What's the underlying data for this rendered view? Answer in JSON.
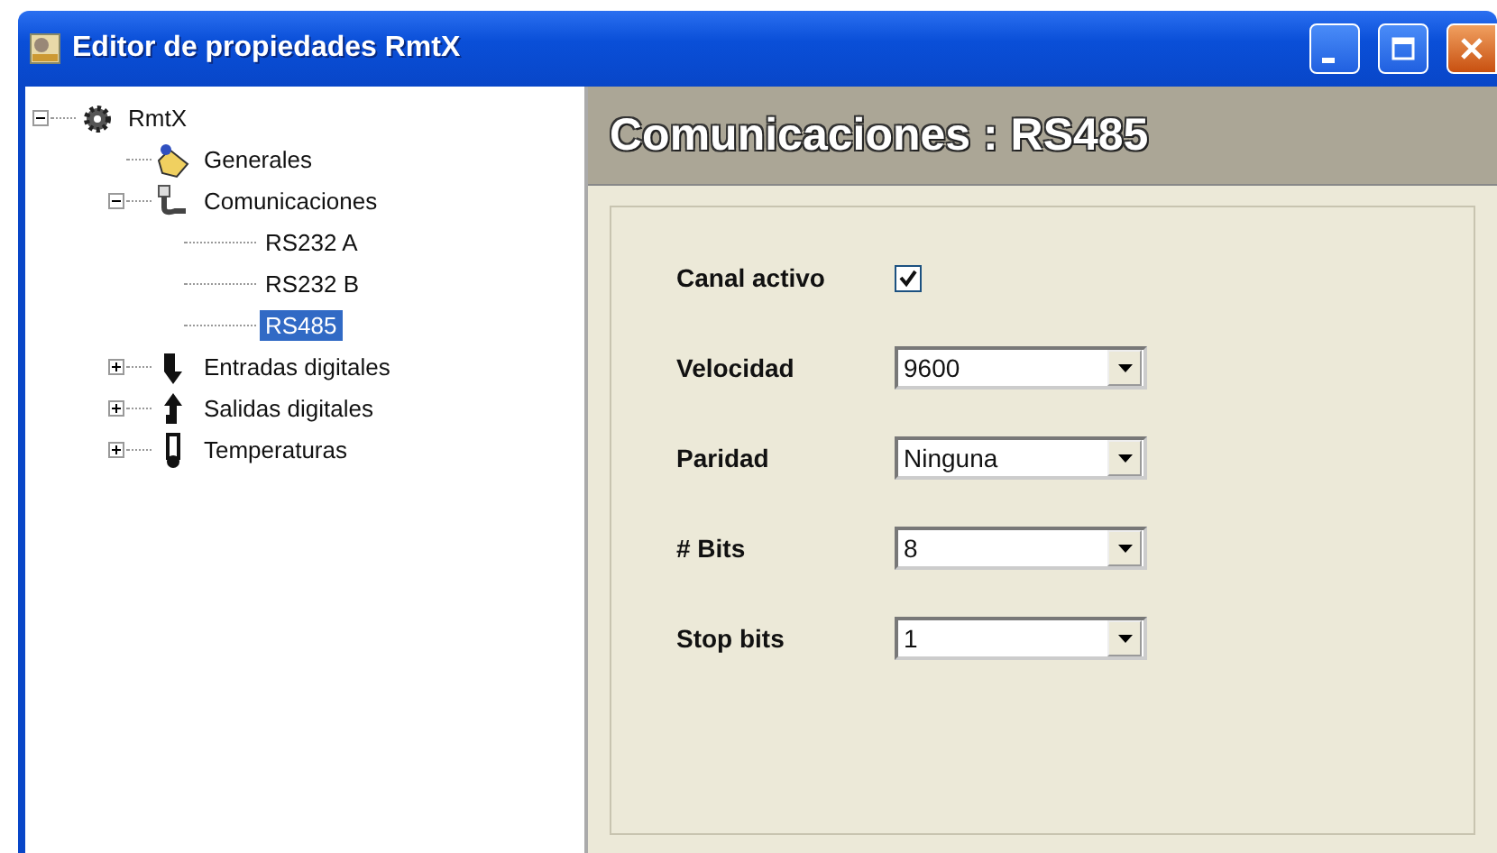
{
  "window": {
    "title": "Editor de propiedades RmtX"
  },
  "tree": [
    {
      "label": "RmtX",
      "kind": "gear",
      "expanded": true,
      "selected": false,
      "children": [
        {
          "label": "Generales",
          "kind": "bag",
          "selected": false
        },
        {
          "label": "Comunicaciones",
          "kind": "cable",
          "expanded": true,
          "selected": false,
          "children": [
            {
              "label": "RS232 A",
              "kind": "none",
              "selected": false
            },
            {
              "label": "RS232 B",
              "kind": "none",
              "selected": false
            },
            {
              "label": "RS485",
              "kind": "none",
              "selected": true
            }
          ]
        },
        {
          "label": "Entradas digitales",
          "kind": "down",
          "expanded": false,
          "selected": false
        },
        {
          "label": "Salidas digitales",
          "kind": "up",
          "expanded": false,
          "selected": false
        },
        {
          "label": "Temperaturas",
          "kind": "thermo",
          "expanded": false,
          "selected": false
        }
      ]
    }
  ],
  "panel": {
    "heading": "Comunicaciones : RS485",
    "fields": [
      {
        "label": "Canal activo",
        "kind": "checkbox",
        "checked": true
      },
      {
        "label": "Velocidad",
        "kind": "combo",
        "value": "9600"
      },
      {
        "label": "Paridad",
        "kind": "combo",
        "value": "Ninguna"
      },
      {
        "label": "# Bits",
        "kind": "combo",
        "value": "8"
      },
      {
        "label": "Stop bits",
        "kind": "combo",
        "value": "1"
      }
    ]
  }
}
